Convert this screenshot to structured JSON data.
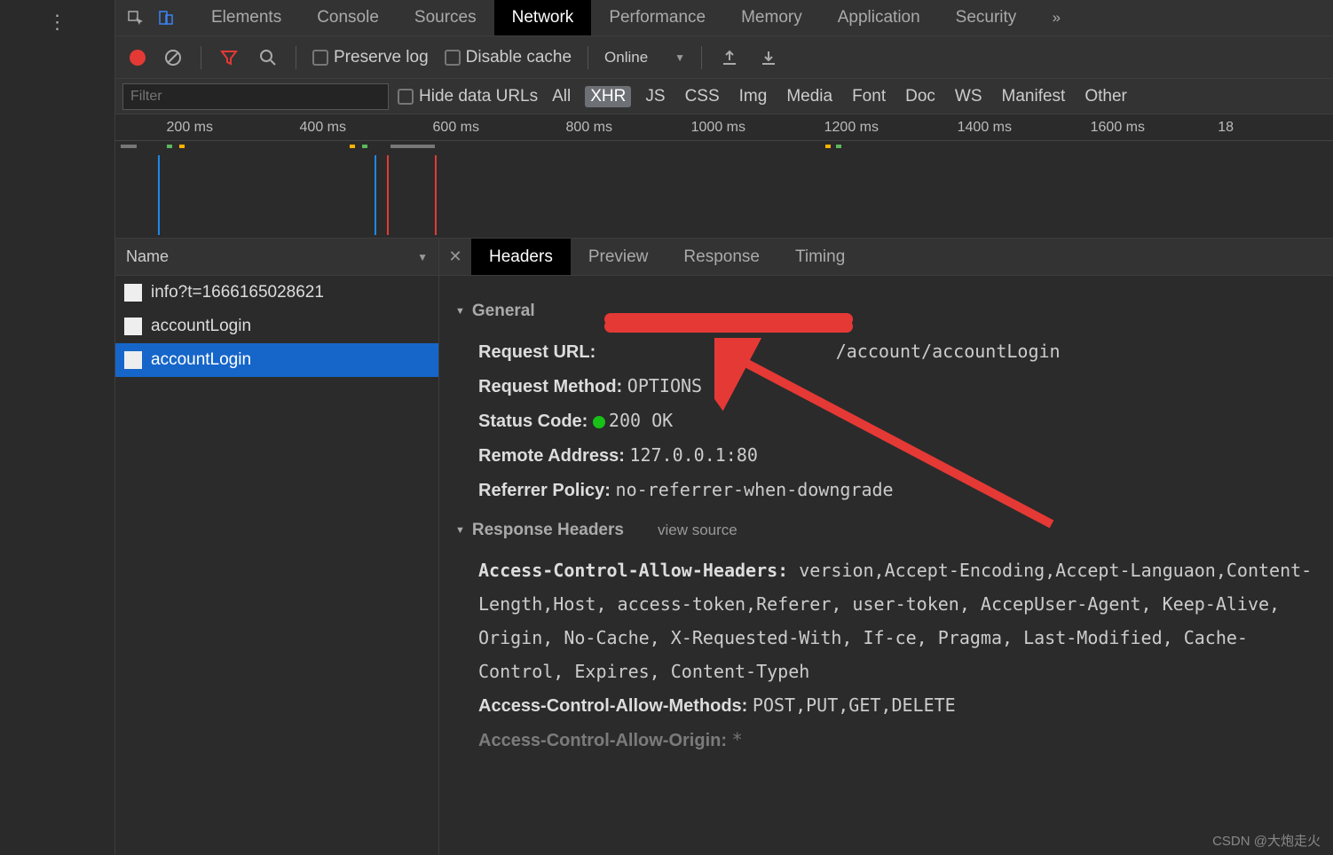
{
  "tabs": {
    "items": [
      "Elements",
      "Console",
      "Sources",
      "Network",
      "Performance",
      "Memory",
      "Application",
      "Security"
    ],
    "active": "Network"
  },
  "toolbar": {
    "preserve_log": "Preserve log",
    "disable_cache": "Disable cache",
    "online_label": "Online"
  },
  "filter": {
    "placeholder": "Filter",
    "hide_data_urls": "Hide data URLs",
    "types": [
      "All",
      "XHR",
      "JS",
      "CSS",
      "Img",
      "Media",
      "Font",
      "Doc",
      "WS",
      "Manifest",
      "Other"
    ],
    "selected": "XHR"
  },
  "timeline": {
    "ticks": [
      "200 ms",
      "400 ms",
      "600 ms",
      "800 ms",
      "1000 ms",
      "1200 ms",
      "1400 ms",
      "1600 ms",
      "18"
    ]
  },
  "requests": {
    "column": "Name",
    "items": [
      {
        "name": "info?t=1666165028621",
        "selected": false
      },
      {
        "name": "accountLogin",
        "selected": false
      },
      {
        "name": "accountLogin",
        "selected": true
      }
    ]
  },
  "details": {
    "tabs": [
      "Headers",
      "Preview",
      "Response",
      "Timing"
    ],
    "active": "Headers",
    "general_label": "General",
    "general": {
      "request_url_label": "Request URL:",
      "request_url_value": "/account/accountLogin",
      "request_method_label": "Request Method:",
      "request_method_value": "OPTIONS",
      "status_code_label": "Status Code:",
      "status_code_value": "200 OK",
      "remote_address_label": "Remote Address:",
      "remote_address_value": "127.0.0.1:80",
      "referrer_policy_label": "Referrer Policy:",
      "referrer_policy_value": "no-referrer-when-downgrade"
    },
    "response_headers_label": "Response Headers",
    "view_source_label": "view source",
    "response_headers": {
      "allow_headers_label": "Access-Control-Allow-Headers:",
      "allow_headers_value": "version,Accept-Encoding,Accept-Languaon,Content-Length,Host, access-token,Referer, user-token, AccepUser-Agent, Keep-Alive, Origin, No-Cache, X-Requested-With, If-ce, Pragma, Last-Modified, Cache-Control, Expires, Content-Typeh",
      "allow_methods_label": "Access-Control-Allow-Methods:",
      "allow_methods_value": "POST,PUT,GET,DELETE",
      "allow_origin_label": "Access-Control-Allow-Origin:",
      "allow_origin_value": "*"
    }
  },
  "watermark": "CSDN @大炮走火"
}
